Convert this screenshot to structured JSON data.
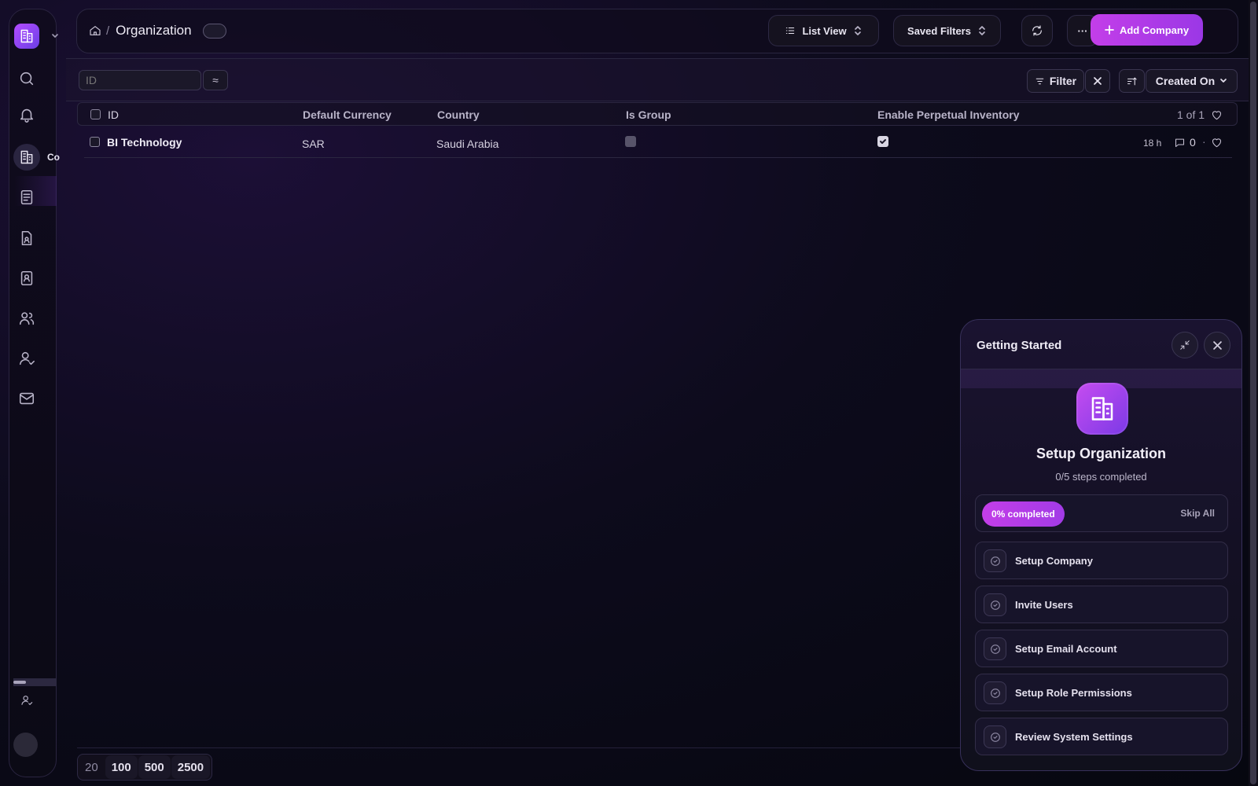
{
  "sidebar": {
    "active_label": "Co",
    "icons": [
      "search-icon",
      "bell-icon",
      "building-icon",
      "document-icon",
      "file-user-icon",
      "contact-book-icon",
      "users-icon",
      "user-icon",
      "mail-icon"
    ]
  },
  "topbar": {
    "breadcrumb_sep": "/",
    "title": "Organization",
    "list_view_label": "List View",
    "saved_filters_label": "Saved Filters",
    "more_label": "···",
    "add_label": "Add Company"
  },
  "filterbar": {
    "id_placeholder": "ID",
    "approx_label": "≈",
    "filter_label": "Filter",
    "sort_label": "Created On"
  },
  "table": {
    "columns": [
      "ID",
      "Default Currency",
      "Country",
      "Is Group",
      "Enable Perpetual Inventory"
    ],
    "count": "1 of 1",
    "rows": [
      {
        "id": "BI Technology",
        "currency": "SAR",
        "country": "Saudi Arabia",
        "is_group": false,
        "perpetual_inventory": true,
        "modified": "18 h",
        "comments": "0",
        "sep": "·"
      }
    ]
  },
  "pager": [
    "20",
    "100",
    "500",
    "2500"
  ],
  "getting_started": {
    "title": "Getting Started",
    "name": "Setup Organization",
    "steps": "0/5 steps completed",
    "progress_label": "0% completed",
    "progress": 0,
    "skip_label": "Skip All",
    "items": [
      "Setup Company",
      "Invite Users",
      "Setup Email Account",
      "Setup Role Permissions",
      "Review System Settings"
    ]
  },
  "colors": {
    "accent": "#c33ee8",
    "accent2": "#9b38e6",
    "bg": "#0d0b1c"
  }
}
